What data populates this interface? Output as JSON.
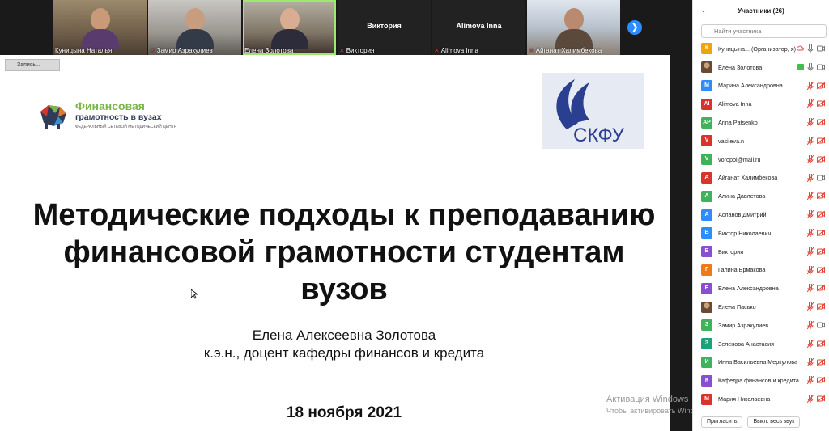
{
  "videos": [
    {
      "name": "Куницына Наталья",
      "muted": false
    },
    {
      "name": "Замир Азракулиев",
      "muted": true
    },
    {
      "name": "Елена Золотова",
      "muted": false
    },
    {
      "name": "Виктория",
      "muted": true,
      "display": "Виктория"
    },
    {
      "name": "Alimova Inna",
      "muted": true,
      "display": "Alimova Inna"
    },
    {
      "name": "Айганат Халимбекова",
      "muted": true
    }
  ],
  "slide": {
    "recording_label": "Запись...",
    "logo_line1": "Финансовая",
    "logo_line2": "грамотность в вузах",
    "logo_line3": "ФЕДЕРАЛЬНЫЙ СЕТЕВОЙ МЕТОДИЧЕСКИЙ ЦЕНТР",
    "skfu_text": "СКФУ",
    "title_line1": "Методические подходы к преподаванию",
    "title_line2": "финансовой грамотности студентам",
    "title_line3": "вузов",
    "author_line1": "Елена Алексеевна Золотова",
    "author_line2": "к.э.н., доцент кафедры финансов и кредита",
    "date": "18 ноября 2021"
  },
  "watermark": {
    "line1": "Активация Windows",
    "line2": "Чтобы активировать Windows, перейдите в раздел \"Параметры\"."
  },
  "panel": {
    "title": "Участники (26)",
    "search_placeholder": "Найти участника",
    "invite_label": "Пригласить",
    "mute_all_label": "Выкл. весь звук"
  },
  "participants": [
    {
      "initial": "К",
      "name": "Куницына... (Организатор, я)",
      "color": "#f0a30a",
      "mic": "on",
      "cam": "on",
      "extra": "cloud"
    },
    {
      "initial": "",
      "name": "Елена Золотова",
      "color": "",
      "photo": true,
      "mic": "on",
      "cam": "on",
      "extra": "green"
    },
    {
      "initial": "М",
      "name": "Марина Александровна",
      "color": "#2d8cff",
      "mic": "off",
      "cam": "off"
    },
    {
      "initial": "AI",
      "name": "Alimova Inna",
      "color": "#d9342b",
      "mic": "off",
      "cam": "off"
    },
    {
      "initial": "AP",
      "name": "Arina Patsenko",
      "color": "#3fb35a",
      "mic": "off",
      "cam": "off"
    },
    {
      "initial": "V",
      "name": "vasileva.n",
      "color": "#d9342b",
      "mic": "off",
      "cam": "off"
    },
    {
      "initial": "V",
      "name": "voropol@mail.ru",
      "color": "#3fb35a",
      "mic": "off",
      "cam": "off"
    },
    {
      "initial": "А",
      "name": "Айганат Халимбекова",
      "color": "#d9342b",
      "mic": "off",
      "cam": "on"
    },
    {
      "initial": "А",
      "name": "Алина Давлетова",
      "color": "#3fb35a",
      "mic": "off",
      "cam": "off"
    },
    {
      "initial": "А",
      "name": "Асланов Дмитрий",
      "color": "#2d8cff",
      "mic": "off",
      "cam": "off"
    },
    {
      "initial": "В",
      "name": "Виктор Николаевич",
      "color": "#2d8cff",
      "mic": "off",
      "cam": "off"
    },
    {
      "initial": "В",
      "name": "Виктория",
      "color": "#8a4fd1",
      "mic": "off",
      "cam": "off"
    },
    {
      "initial": "Г",
      "name": "Галина Ермакова",
      "color": "#f07a1a",
      "mic": "off",
      "cam": "off"
    },
    {
      "initial": "Е",
      "name": "Елена Александровна",
      "color": "#8a4fd1",
      "mic": "off",
      "cam": "off"
    },
    {
      "initial": "",
      "name": "Елена Пасько",
      "color": "",
      "photo": true,
      "mic": "off",
      "cam": "off"
    },
    {
      "initial": "З",
      "name": "Замир Азракулиев",
      "color": "#3fb35a",
      "mic": "off",
      "cam": "on"
    },
    {
      "initial": "З",
      "name": "Зеленова Анастасия",
      "color": "#1aa37a",
      "mic": "off",
      "cam": "off"
    },
    {
      "initial": "И",
      "name": "Инна Васильевна Меркулова",
      "color": "#3fb35a",
      "mic": "off",
      "cam": "off"
    },
    {
      "initial": "К",
      "name": "Кафедра финансов и кредита",
      "color": "#8a4fd1",
      "mic": "off",
      "cam": "off"
    },
    {
      "initial": "М",
      "name": "Мария Николаевна",
      "color": "#d9342b",
      "mic": "off",
      "cam": "off"
    }
  ]
}
